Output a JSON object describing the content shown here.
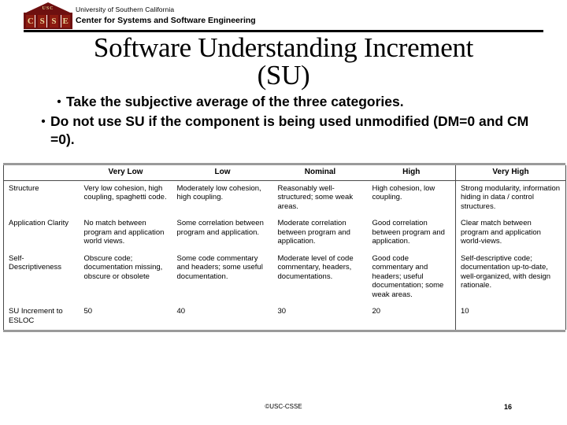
{
  "masthead": {
    "logo": {
      "usc_text": "USC",
      "letters": [
        "C",
        "S",
        "S",
        "E"
      ],
      "color": "#6e1010"
    },
    "university": "University of Southern California",
    "center": "Center for Systems and Software Engineering"
  },
  "slide": {
    "title_line1": "Software Understanding Increment",
    "title_line2": "(SU)",
    "bullets": [
      "Take the subjective average of the three categories.",
      "Do not use SU if the component is being used unmodified (DM=0 and CM =0)."
    ]
  },
  "table": {
    "corner_label": "",
    "columns": [
      "Very Low",
      "Low",
      "Nominal",
      "High",
      "Very High"
    ],
    "rows": [
      {
        "label": "Structure",
        "cells": [
          "Very low cohesion, high coupling, spaghetti code.",
          "Moderately low cohesion, high coupling.",
          "Reasonably well-structured; some weak areas.",
          "High cohesion, low coupling.",
          "Strong modularity, information hiding in data / control structures."
        ]
      },
      {
        "label": "Application Clarity",
        "cells": [
          "No match between program and application world views.",
          "Some correlation between program and application.",
          "Moderate correlation between program and application.",
          "Good correlation between program and application.",
          "Clear match between program and application world-views."
        ]
      },
      {
        "label": "Self-Descriptiveness",
        "cells": [
          "Obscure code; documentation missing, obscure or obsolete",
          "Some code commentary and headers; some useful documentation.",
          "Moderate level of code commentary, headers, documentations.",
          "Good code commentary and headers; useful documentation; some weak areas.",
          "Self-descriptive code; documentation up-to-date, well-organized, with design rationale."
        ]
      },
      {
        "label": "SU Increment to ESLOC",
        "cells": [
          "50",
          "40",
          "30",
          "20",
          "10"
        ]
      }
    ]
  },
  "footer": {
    "copyright": "©USC-CSSE",
    "page_number": "16"
  }
}
